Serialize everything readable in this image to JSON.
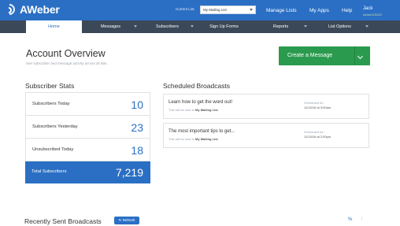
{
  "header": {
    "logo_text": "AWeber",
    "current_list_label": "Current List:",
    "current_list_value": "My Mailing List",
    "links": [
      "Manage Lists",
      "My Apps",
      "Help"
    ],
    "user_name": "Jack",
    "user_id": "Acme123123"
  },
  "nav": {
    "items": [
      "Home",
      "Messages",
      "Subscribers",
      "Sign Up Forms",
      "Reports",
      "List Options"
    ]
  },
  "overview": {
    "title": "Account Overview",
    "subtitle": "See subscriber and message activity across all lists.",
    "create_button": "Create a Message"
  },
  "stats": {
    "title": "Subscriber Stats",
    "rows": [
      {
        "label": "Subscribers Today",
        "value": "10"
      },
      {
        "label": "Subscribers Yesterday",
        "value": "23"
      },
      {
        "label": "Unsubscribed Today",
        "value": "18"
      }
    ],
    "total": {
      "label": "Total Subscribers",
      "value": "7,219"
    }
  },
  "scheduled": {
    "title": "Scheduled Broadcasts",
    "items": [
      {
        "subject": "Learn how to get the word out!",
        "sent_prefix": "This will be sent to",
        "list": "My Mailing List",
        "scheduled_label": "Scheduled for:",
        "date": "11/15/16 at 9:00am"
      },
      {
        "subject": "The most important tips to get...",
        "sent_prefix": "This will be sent to",
        "list": "My Mailing List",
        "scheduled_label": "Scheduled for:",
        "date": "11/15/16 at 2:00pm"
      }
    ]
  },
  "recent": {
    "title": "Recently Sent Broadcasts",
    "refresh_label": "Refresh"
  },
  "colors": {
    "brand_blue": "#2a6fc4",
    "nav_dark": "#3b4857",
    "create_green": "#2a9b4e"
  }
}
